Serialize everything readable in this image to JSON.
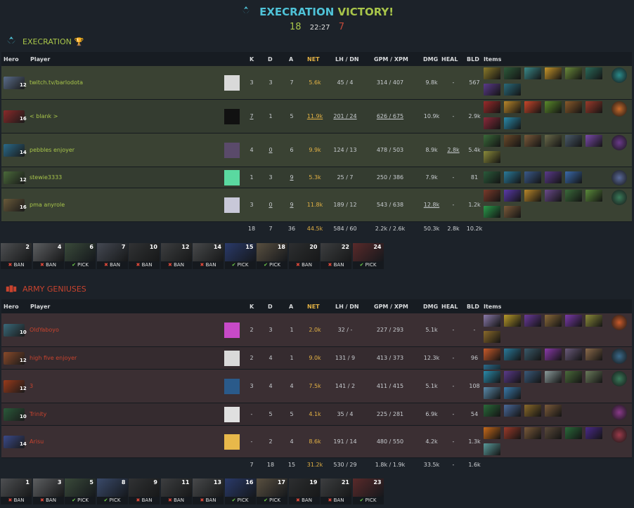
{
  "header": {
    "team": "EXECRATION",
    "win_word": "VICTORY!",
    "radiant_score": "18",
    "time": "22:27",
    "dire_score": "7"
  },
  "radiant": {
    "name": "EXECRATION",
    "headers": {
      "hero": "Hero",
      "player": "Player",
      "k": "K",
      "d": "D",
      "a": "A",
      "net": "NET",
      "lhdn": "LH / DN",
      "gpmxpm": "GPM / XPM",
      "dmg": "DMG",
      "heal": "HEAL",
      "bld": "BLD",
      "items": "Items"
    },
    "players": [
      {
        "level": "12",
        "name": "twitch.tv/barlodota",
        "k": "3",
        "d": "3",
        "a": "7",
        "net": "5.6k",
        "lh": "45",
        "dn": "4",
        "gpm": "314",
        "xpm": "407",
        "dmg": "9.8k",
        "heal": "-",
        "bld": "567",
        "hero_color": "#5a6d8a",
        "avatar_color": "#d9d9d9",
        "item_colors": [
          "#8a7a2a",
          "#2d5a3a",
          "#3a8a8a",
          "#c8962a",
          "#6a8a3a",
          "#2a6a5a",
          "#5a3a8a",
          "#2a6a7a"
        ],
        "neutral_color": "#2a8a8a"
      },
      {
        "level": "16",
        "name": "< blank >",
        "k": "7",
        "d": "1",
        "a": "5",
        "net": "11.9k",
        "lh": "201",
        "dn": "24",
        "gpm": "626",
        "xpm": "675",
        "dmg": "10.9k",
        "heal": "-",
        "bld": "2.9k",
        "hero_color": "#8a2a2a",
        "avatar_color": "#111111",
        "item_colors": [
          "#9a2a2a",
          "#b8862a",
          "#c8462a",
          "#5a8a2a",
          "#8a5a2a",
          "#9a3a2a",
          "#8a2a3a",
          "#2a8aaa"
        ],
        "neutral_color": "#c86a2a"
      },
      {
        "level": "14",
        "name": "pebbles enjoyer",
        "k": "4",
        "d": "0",
        "a": "6",
        "net": "9.9k",
        "lh": "124",
        "dn": "13",
        "gpm": "478",
        "xpm": "503",
        "dmg": "8.9k",
        "heal": "2.8k",
        "bld": "5.4k",
        "hero_color": "#2a6a8a",
        "avatar_color": "#5a4a6a",
        "item_colors": [
          "#3a6a3a",
          "#6a4a2a",
          "#7a5a3a",
          "#6a6a4a",
          "#4a5a6a",
          "#7a4aaa",
          "#8a8a3a"
        ],
        "neutral_color": "#6a3a8a"
      },
      {
        "level": "12",
        "name": "stewie3333",
        "k": "1",
        "d": "3",
        "a": "9",
        "net": "5.3k",
        "lh": "25",
        "dn": "7",
        "gpm": "250",
        "xpm": "386",
        "dmg": "7.9k",
        "heal": "-",
        "bld": "81",
        "hero_color": "#4a6a3a",
        "avatar_color": "#5ad9a0",
        "item_colors": [
          "#2a5a3a",
          "#2a7a9a",
          "#3a5a8a",
          "#5a3a8a",
          "#3a6aaa"
        ],
        "neutral_color": "#5a6a9a"
      },
      {
        "level": "16",
        "name": "pma anyrole",
        "k": "3",
        "d": "0",
        "a": "9",
        "net": "11.8k",
        "lh": "189",
        "dn": "12",
        "gpm": "543",
        "xpm": "638",
        "dmg": "12.8k",
        "heal": "-",
        "bld": "1.2k",
        "hero_color": "#6a5a3a",
        "avatar_color": "#c8c8d8",
        "item_colors": [
          "#7a3a2a",
          "#5a3aaa",
          "#b8862a",
          "#6a4a8a",
          "#3a6a3a",
          "#5a8a3a",
          "#2a9a4a",
          "#7a5a3a"
        ],
        "neutral_color": "#3a7a5a"
      }
    ],
    "totals": {
      "k": "18",
      "d": "7",
      "a": "36",
      "net": "44.5k",
      "lhdn": "584 / 60",
      "gpmxpm": "2.2k / 2.6k",
      "dmg": "50.3k",
      "heal": "2.8k",
      "bld": "10.2k"
    },
    "draft": [
      {
        "num": "2",
        "tag": "BAN"
      },
      {
        "num": "4",
        "tag": "BAN"
      },
      {
        "num": "6",
        "tag": "PICK"
      },
      {
        "num": "7",
        "tag": "BAN"
      },
      {
        "num": "10",
        "tag": "BAN"
      },
      {
        "num": "12",
        "tag": "BAN"
      },
      {
        "num": "14",
        "tag": "BAN"
      },
      {
        "num": "15",
        "tag": "PICK"
      },
      {
        "num": "18",
        "tag": "PICK"
      },
      {
        "num": "20",
        "tag": "BAN"
      },
      {
        "num": "22",
        "tag": "BAN"
      },
      {
        "num": "24",
        "tag": "PICK"
      }
    ]
  },
  "dire": {
    "name": "ARMY GENIUSES",
    "headers": {
      "hero": "Hero",
      "player": "Player",
      "k": "K",
      "d": "D",
      "a": "A",
      "net": "NET",
      "lhdn": "LH / DN",
      "gpmxpm": "GPM / XPM",
      "dmg": "DMG",
      "heal": "HEAL",
      "bld": "BLD",
      "items": "Items"
    },
    "players": [
      {
        "level": "10",
        "name": "OldYaboyo",
        "k": "2",
        "d": "3",
        "a": "1",
        "net": "2.0k",
        "lh": "32",
        "dn": "-",
        "gpm": "227",
        "xpm": "293",
        "dmg": "5.1k",
        "heal": "-",
        "bld": "-",
        "hero_color": "#3a6a7a",
        "avatar_color": "#c84ac8",
        "item_colors": [
          "#8a7aaa",
          "#b89a2a",
          "#6a3a9a",
          "#8a6a3a",
          "#7a3aaa",
          "#8a8a3a",
          "#8a6a2a"
        ],
        "neutral_color": "#c85a2a"
      },
      {
        "level": "12",
        "name": "high five enjoyer",
        "k": "2",
        "d": "4",
        "a": "1",
        "net": "9.0k",
        "lh": "131",
        "dn": "9",
        "gpm": "413",
        "xpm": "373",
        "dmg": "12.3k",
        "heal": "-",
        "bld": "96",
        "hero_color": "#8a4a2a",
        "avatar_color": "#d9d9d9",
        "item_colors": [
          "#c85a2a",
          "#2a7a9a",
          "#3a5a6a",
          "#8a3aaa",
          "#6a5a7a",
          "#8a6a4a",
          "#2a6a8a"
        ],
        "neutral_color": "#3a6a8a"
      },
      {
        "level": "12",
        "name": "3",
        "k": "3",
        "d": "4",
        "a": "4",
        "net": "7.5k",
        "lh": "141",
        "dn": "2",
        "gpm": "411",
        "xpm": "415",
        "dmg": "5.1k",
        "heal": "-",
        "bld": "108",
        "hero_color": "#9a3a1a",
        "avatar_color": "#2a5a8a",
        "item_colors": [
          "#2a8aaa",
          "#5a3a8a",
          "#3a5a7a",
          "#8a9a9a",
          "#4a6a3a",
          "#6a7a5a",
          "#5a8aaa",
          "#3a7aaa"
        ],
        "neutral_color": "#3a7a5a"
      },
      {
        "level": "10",
        "name": "Trinity",
        "k": "-",
        "d": "5",
        "a": "5",
        "net": "4.1k",
        "lh": "35",
        "dn": "4",
        "gpm": "225",
        "xpm": "281",
        "dmg": "6.9k",
        "heal": "-",
        "bld": "54",
        "hero_color": "#2a5a3a",
        "avatar_color": "#e0e0e0",
        "item_colors": [
          "#2a6a3a",
          "#4a6a9a",
          "#8a6a2a",
          "#7a5a3a"
        ],
        "neutral_color": "#8a3a8a"
      },
      {
        "level": "14",
        "name": "Arisu",
        "k": "-",
        "d": "2",
        "a": "4",
        "net": "8.6k",
        "lh": "191",
        "dn": "14",
        "gpm": "480",
        "xpm": "550",
        "dmg": "4.2k",
        "heal": "-",
        "bld": "1.3k",
        "hero_color": "#3a4a8a",
        "avatar_color": "#e8b84a",
        "item_colors": [
          "#c86a1a",
          "#9a3a2a",
          "#7a5a3a",
          "#5a4a3a",
          "#2a6a3a",
          "#4a2a8a",
          "#5a9a9a"
        ],
        "neutral_color": "#9a3a4a"
      }
    ],
    "totals": {
      "k": "7",
      "d": "18",
      "a": "15",
      "net": "31.2k",
      "lhdn": "530 / 29",
      "gpmxpm": "1.8k / 1.9k",
      "dmg": "33.5k",
      "heal": "-",
      "bld": "1.6k"
    },
    "draft": [
      {
        "num": "1",
        "tag": "BAN"
      },
      {
        "num": "3",
        "tag": "BAN"
      },
      {
        "num": "5",
        "tag": "PICK"
      },
      {
        "num": "8",
        "tag": "PICK"
      },
      {
        "num": "9",
        "tag": "BAN"
      },
      {
        "num": "11",
        "tag": "BAN"
      },
      {
        "num": "13",
        "tag": "BAN"
      },
      {
        "num": "16",
        "tag": "PICK"
      },
      {
        "num": "17",
        "tag": "PICK"
      },
      {
        "num": "19",
        "tag": "BAN"
      },
      {
        "num": "21",
        "tag": "BAN"
      },
      {
        "num": "23",
        "tag": "PICK"
      }
    ]
  },
  "icons": {
    "team_logo": "execration-logo-icon",
    "trophy": "trophy-icon",
    "dire_logo": "army-geniuses-logo-icon",
    "ban_mark": "x-icon",
    "pick_mark": "check-icon"
  }
}
